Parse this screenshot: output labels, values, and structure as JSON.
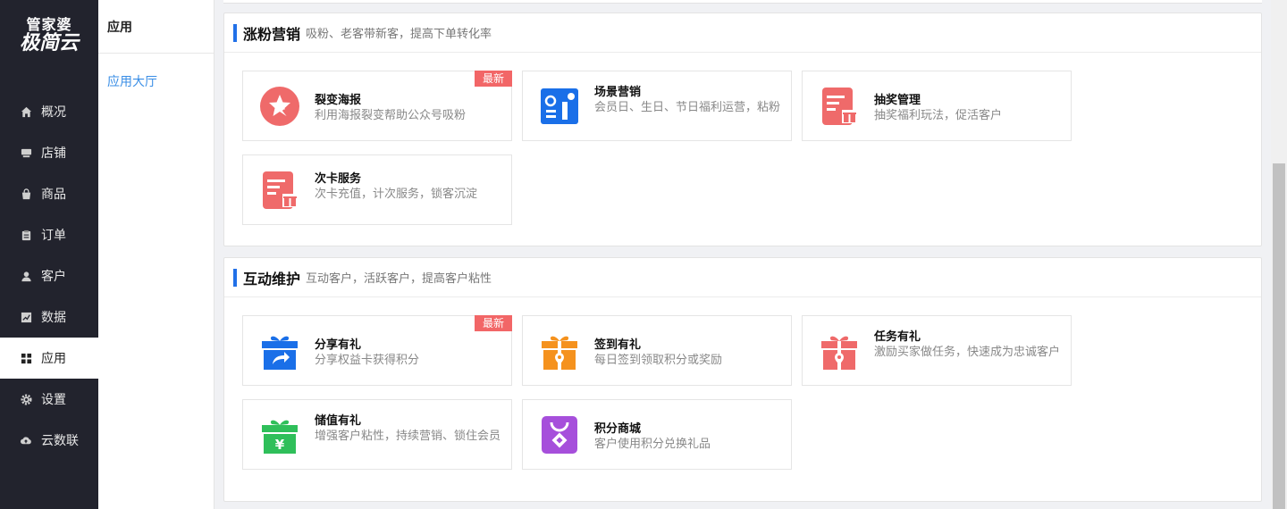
{
  "logo": {
    "line1": "管家婆",
    "line2": "极简云"
  },
  "nav": {
    "items": [
      {
        "label": "概况",
        "icon": "home-icon"
      },
      {
        "label": "店铺",
        "icon": "store-icon"
      },
      {
        "label": "商品",
        "icon": "bag-icon"
      },
      {
        "label": "订单",
        "icon": "clipboard-icon"
      },
      {
        "label": "客户",
        "icon": "user-icon"
      },
      {
        "label": "数据",
        "icon": "chart-icon"
      },
      {
        "label": "应用",
        "icon": "grid-icon",
        "active": true
      },
      {
        "label": "设置",
        "icon": "gear-icon"
      },
      {
        "label": "云数联",
        "icon": "cloud-upload-icon"
      }
    ]
  },
  "subnav": {
    "title": "应用",
    "link": "应用大厅"
  },
  "sections": [
    {
      "title": "涨粉营销",
      "subtitle": "吸粉、老客带新客，提高下单转化率",
      "cards": [
        {
          "name": "裂变海报",
          "desc": "利用海报裂变帮助公众号吸粉",
          "badge": "最新",
          "icon": "star-poster-icon",
          "color": "#ef6a6a"
        },
        {
          "name": "场景营销",
          "desc": "会员日、生日、节日福利运营，粘粉",
          "badge": "",
          "icon": "scene-card-icon",
          "color": "#1a6fe8"
        },
        {
          "name": "抽奖管理",
          "desc": "抽奖福利玩法，促活客户",
          "badge": "",
          "icon": "lottery-icon",
          "color": "#ef6a6a"
        },
        {
          "name": "次卡服务",
          "desc": "次卡充值，计次服务，锁客沉淀",
          "badge": "",
          "icon": "count-card-icon",
          "color": "#ef6a6a"
        }
      ]
    },
    {
      "title": "互动维护",
      "subtitle": "互动客户，活跃客户，提高客户粘性",
      "cards": [
        {
          "name": "分享有礼",
          "desc": "分享权益卡获得积分",
          "badge": "最新",
          "icon": "share-gift-icon",
          "color": "#1a6fe8"
        },
        {
          "name": "签到有礼",
          "desc": "每日签到领取积分或奖励",
          "badge": "",
          "icon": "checkin-gift-icon",
          "color": "#f5921e"
        },
        {
          "name": "任务有礼",
          "desc": "激励买家做任务，快速成为忠诚客户",
          "badge": "",
          "icon": "task-gift-icon",
          "color": "#ef6a6a"
        },
        {
          "name": "储值有礼",
          "desc": "增强客户粘性，持续营销、锁住会员",
          "badge": "",
          "icon": "stored-value-gift-icon",
          "color": "#2fbf5a"
        },
        {
          "name": "积分商城",
          "desc": "客户使用积分兑换礼品",
          "badge": "",
          "icon": "points-mall-icon",
          "color": "#a64fdb"
        }
      ]
    }
  ]
}
